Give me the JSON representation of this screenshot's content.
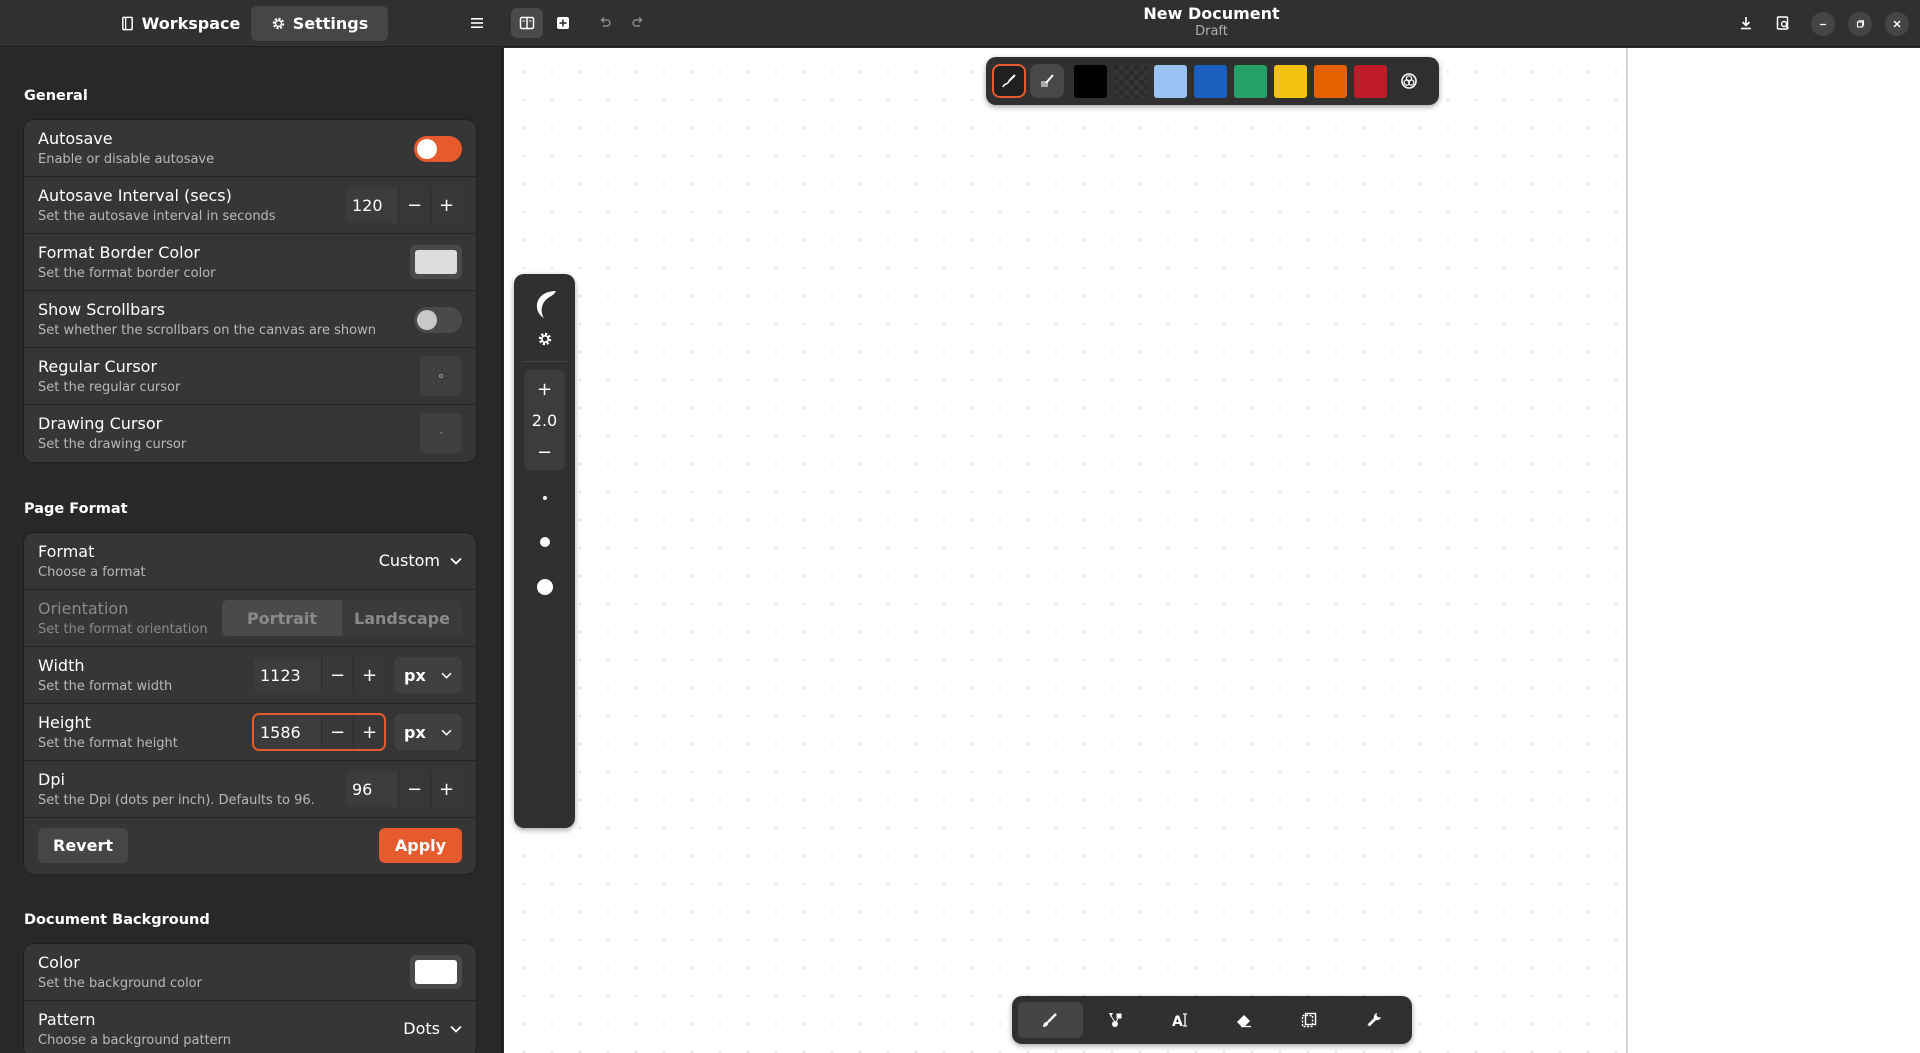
{
  "sidebar": {
    "workspace_label": "Workspace",
    "settings_label": "Settings"
  },
  "general": {
    "title": "General",
    "autosave": {
      "title": "Autosave",
      "subtitle": "Enable or disable autosave",
      "enabled": true
    },
    "autosave_interval": {
      "title": "Autosave Interval (secs)",
      "subtitle": "Set the autosave interval in seconds",
      "value": "120"
    },
    "format_border_color": {
      "title": "Format Border Color",
      "subtitle": "Set the format border color",
      "color": "#dcdcdc"
    },
    "show_scrollbars": {
      "title": "Show Scrollbars",
      "subtitle": "Set whether the scrollbars on the canvas are shown",
      "enabled": false
    },
    "regular_cursor": {
      "title": "Regular Cursor",
      "subtitle": "Set the regular cursor"
    },
    "drawing_cursor": {
      "title": "Drawing Cursor",
      "subtitle": "Set the drawing cursor"
    }
  },
  "page_format": {
    "title": "Page Format",
    "format": {
      "title": "Format",
      "subtitle": "Choose a format",
      "value": "Custom"
    },
    "orientation": {
      "title": "Orientation",
      "subtitle": "Set the format orientation",
      "portrait": "Portrait",
      "landscape": "Landscape"
    },
    "width": {
      "title": "Width",
      "subtitle": "Set the format width",
      "value": "1123",
      "unit": "px"
    },
    "height": {
      "title": "Height",
      "subtitle": "Set the format height",
      "value": "1586",
      "unit": "px"
    },
    "dpi": {
      "title": "Dpi",
      "subtitle": "Set the Dpi (dots per inch). Defaults to 96.",
      "value": "96"
    },
    "revert_label": "Revert",
    "apply_label": "Apply"
  },
  "document_background": {
    "title": "Document Background",
    "color": {
      "title": "Color",
      "subtitle": "Set the background color",
      "color": "#ffffff"
    },
    "pattern": {
      "title": "Pattern",
      "subtitle": "Choose a background pattern",
      "value": "Dots"
    }
  },
  "header": {
    "title": "New Document",
    "subtitle": "Draft"
  },
  "palette": {
    "colors": [
      "#000000",
      "#2a2a2a",
      "#99c1f1",
      "#1c5fbf",
      "#26a269",
      "#f5c211",
      "#e66100",
      "#c01c28"
    ]
  },
  "stroke": {
    "width_value": "2.0"
  },
  "colors": {
    "accent": "#e55b2d",
    "sidebar_bg": "#282828",
    "canvas_bg": "#ffffff"
  }
}
